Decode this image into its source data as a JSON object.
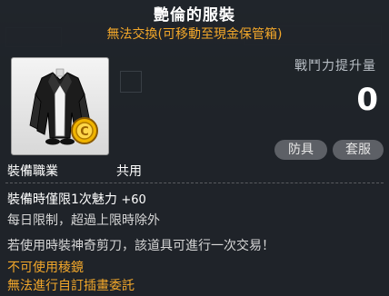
{
  "item": {
    "name": "艷倫的服裝",
    "trade_note": "無法交換(可移動至現金保管箱)",
    "icon": "black-coat-with-gold-coin-icon",
    "colors": {
      "title": "#ffffff",
      "notice": "#f2a72a",
      "text": "#d6d6d6"
    }
  },
  "stats": {
    "power_label": "戰鬥力提升量",
    "power_value": "0",
    "tags": [
      "防具",
      "套服"
    ]
  },
  "job": {
    "label": "裝備職業",
    "value": "共用"
  },
  "effect": {
    "main": "裝備時僅限1次魅力",
    "bonus": "+60",
    "limit": "每日限制，超過上限時除外"
  },
  "notes": {
    "scissors": "若使用時裝神奇剪刀，該道具可進行一次交易！",
    "no_prism": "不可使用稜鏡",
    "no_store": "無法進行自訂插畫委託"
  }
}
